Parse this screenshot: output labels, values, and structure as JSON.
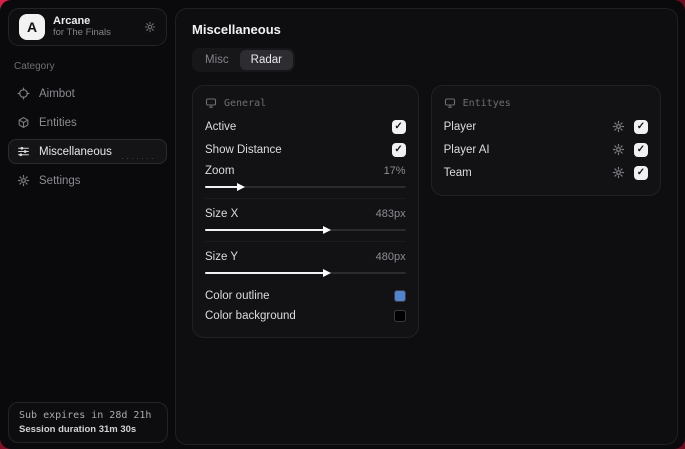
{
  "colors": {
    "backdrop": "#c2193c",
    "window_bg": "#0a0a0c",
    "accent_check_bg": "#f1f1f1",
    "outline_swatch": "#5084cf",
    "background_swatch": "#000000"
  },
  "glyphs": {
    "check": "✓",
    "dots": "·······"
  },
  "sidebar": {
    "brand": {
      "logo_letter": "A",
      "title": "Arcane",
      "subtitle": "for The Finals"
    },
    "category_label": "Category",
    "items": [
      {
        "label": "Aimbot",
        "icon": "crosshair-icon",
        "selected": false
      },
      {
        "label": "Entities",
        "icon": "box-icon",
        "selected": false
      },
      {
        "label": "Miscellaneous",
        "icon": "sliders-icon",
        "selected": true
      },
      {
        "label": "Settings",
        "icon": "gear-icon",
        "selected": false
      }
    ],
    "session": {
      "line1": "Sub expires in 28d 21h",
      "line2": "Session duration 31m 30s"
    }
  },
  "main": {
    "title": "Miscellaneous",
    "tabs": [
      {
        "label": "Misc",
        "active": false
      },
      {
        "label": "Radar",
        "active": true
      }
    ],
    "general_panel": {
      "header": "General",
      "toggles": [
        {
          "label": "Active",
          "checked": true
        },
        {
          "label": "Show Distance",
          "checked": true
        }
      ],
      "sliders": [
        {
          "label": "Zoom",
          "value": "17%",
          "fill_percent": 17
        },
        {
          "label": "Size X",
          "value": "483px",
          "fill_percent": 60
        },
        {
          "label": "Size Y",
          "value": "480px",
          "fill_percent": 60
        }
      ],
      "colors": [
        {
          "label": "Color outline",
          "swatch": "#5084cf"
        },
        {
          "label": "Color background",
          "swatch": "#000000"
        }
      ]
    },
    "entities_panel": {
      "header": "Entityes",
      "rows": [
        {
          "label": "Player",
          "checked": true
        },
        {
          "label": "Player AI",
          "checked": true
        },
        {
          "label": "Team",
          "checked": true
        }
      ]
    }
  }
}
